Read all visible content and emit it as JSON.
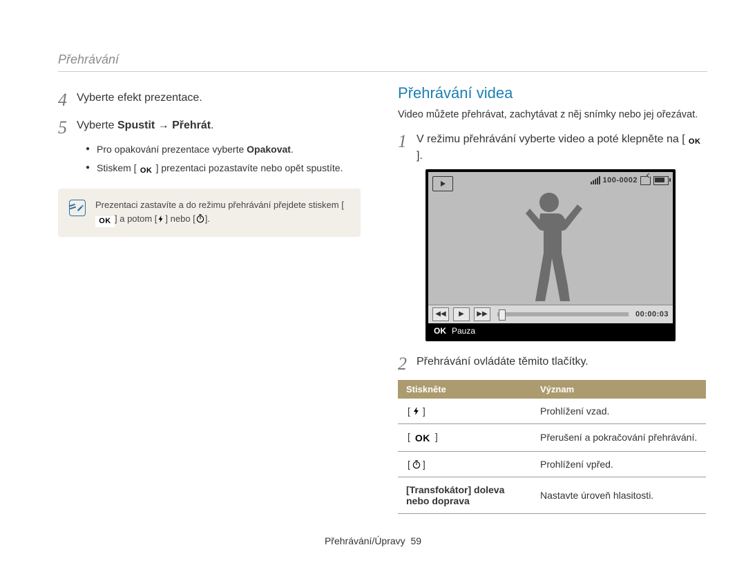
{
  "header": {
    "running": "Přehrávání"
  },
  "left": {
    "step4_num": "4",
    "step4_text": "Vyberte efekt prezentace.",
    "step5_num": "5",
    "step5_pre": "Vyberte ",
    "step5_bold": "Spustit → Přehrát",
    "step5_post": ".",
    "bullet1_pre": "Pro opakování prezentace vyberte ",
    "bullet1_bold": "Opakovat",
    "bullet1_post": ".",
    "bullet2_pre": "Stiskem [",
    "bullet2_post": "] prezentaci pozastavíte nebo opět spustíte.",
    "note_pre": "Prezentaci zastavíte a do režimu přehrávání přejdete stiskem [",
    "note_mid": "] a potom [",
    "note_or": "] nebo [",
    "note_end": "]."
  },
  "right": {
    "h2": "Přehrávání videa",
    "intro": "Video můžete přehrávat, zachytávat z něj snímky nebo jej ořezávat.",
    "step1_num": "1",
    "step1_pre": "V režimu přehrávání vyberte video a poté klepněte na [",
    "step1_post": "].",
    "video": {
      "counter": "100-0002",
      "time": "00:00:03",
      "footer_ok": "OK",
      "footer_label": "Pauza"
    },
    "step2_num": "2",
    "step2_text": "Přehrávání ovládáte těmito tlačítky.",
    "table": {
      "head1": "Stiskněte",
      "head2": "Význam",
      "rows": [
        {
          "meaning": "Prohlížení vzad."
        },
        {
          "meaning": "Přerušení a pokračování přehrávání."
        },
        {
          "meaning": "Prohlížení vpřed."
        },
        {
          "key_text": "[Transfokátor] doleva nebo doprava",
          "meaning": "Nastavte úroveň hlasitosti."
        }
      ]
    }
  },
  "footer": {
    "section": "Přehrávání/Úpravy",
    "page": "59"
  },
  "icons": {
    "ok": "OK"
  }
}
